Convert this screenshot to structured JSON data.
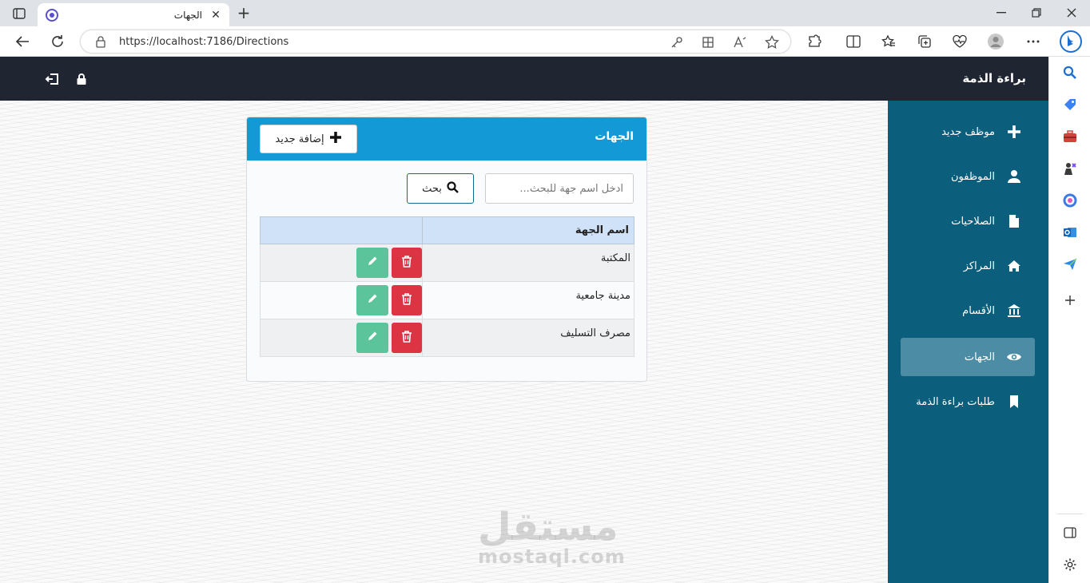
{
  "browser": {
    "tab_title": "الجهات",
    "tab_close": "✕",
    "new_tab": "+",
    "url": "https://localhost:7186/Directions"
  },
  "app": {
    "brand": "براءة الذمة"
  },
  "sidebar": {
    "items": [
      {
        "label": "موظف جديد",
        "icon": "plus-icon"
      },
      {
        "label": "الموظفون",
        "icon": "user-icon"
      },
      {
        "label": "الصلاحيات",
        "icon": "file-icon"
      },
      {
        "label": "المراكز",
        "icon": "home-icon"
      },
      {
        "label": "الأقسام",
        "icon": "bank-icon"
      },
      {
        "label": "الجهات",
        "icon": "eye-icon",
        "active": true
      },
      {
        "label": "طلبات براءة الذمة",
        "icon": "bookmark-icon"
      }
    ]
  },
  "card": {
    "title": "الجهات",
    "add_button": "إضافة جديد",
    "search_placeholder": "ادخل اسم جهة للبحث...",
    "search_button": "بحث",
    "table": {
      "headers": [
        "اسم الجهة",
        ""
      ],
      "rows": [
        {
          "name": "المكتبة"
        },
        {
          "name": "مدينة جامعية"
        },
        {
          "name": "مصرف التسليف"
        }
      ]
    }
  },
  "watermark": {
    "arabic": "مستقل",
    "latin": "mostaql.com"
  },
  "colors": {
    "header_dark": "#1f2631",
    "sidebar": "#0c5e7d",
    "sidebar_active": "#4c8ca5",
    "card_header": "#1399d5",
    "edit": "#5cc49b",
    "delete": "#dd3444"
  }
}
